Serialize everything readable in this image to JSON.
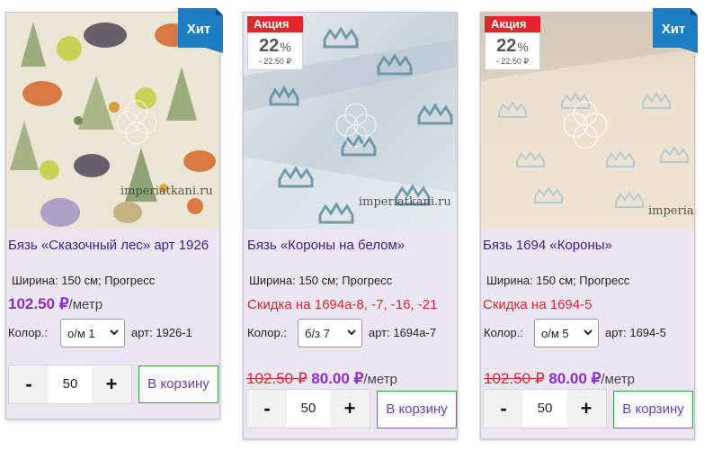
{
  "products": [
    {
      "badge": "Хит",
      "title": "Бязь «Сказочный лес» арт 1926",
      "attributes": "Ширина: 150 см; Прогресс",
      "price": "102.50 ₽",
      "price_unit": "/метр",
      "color_label": "Колор.:",
      "color_option": "о/м 1",
      "article": "арт: 1926-1",
      "qty_minus": "-",
      "qty_value": "50",
      "qty_plus": "+",
      "cart_label": "В корзину",
      "watermark": "imperiatkani.ru"
    },
    {
      "sale_label": "Акция",
      "sale_percent": "22",
      "sale_percent_sign": "%",
      "sale_amount": "- 22.50 ₽",
      "title": "Бязь «Короны на белом»",
      "attributes": "Ширина: 150 см; Прогресс",
      "discount_text": "Скидка на 1694а-8, -7, -16, -21",
      "color_label": "Колор.:",
      "color_option": "б/з 7",
      "article": "арт: 1694а-7",
      "old_price": "102.50 ₽",
      "new_price": "80.00 ₽",
      "price_unit": "/метр",
      "qty_minus": "-",
      "qty_value": "50",
      "qty_plus": "+",
      "cart_label": "В корзину",
      "watermark": "imperiatkani.ru"
    },
    {
      "badge": "Хит",
      "sale_label": "Акция",
      "sale_percent": "22",
      "sale_percent_sign": "%",
      "sale_amount": "- 22.50 ₽",
      "title": "Бязь 1694 «Короны»",
      "attributes": "Ширина: 150 см; Прогресс",
      "discount_text": "Скидка на 1694-5",
      "color_label": "Колор.:",
      "color_option": "о/м 5",
      "article": "арт: 1694-5",
      "old_price": "102.50 ₽",
      "new_price": "80.00 ₽",
      "price_unit": "/метр",
      "qty_minus": "-",
      "qty_value": "50",
      "qty_plus": "+",
      "cart_label": "В корзину",
      "watermark": "imperiat"
    }
  ],
  "colors": {
    "title": "#3c1f8c",
    "price": "#8b2fc9",
    "discount": "#e3262b",
    "hit_badge": "#1e7fc4",
    "sale_badge": "#e3262b",
    "card_bg": "#ece6f2",
    "cart_border": "#3f9a3f"
  }
}
